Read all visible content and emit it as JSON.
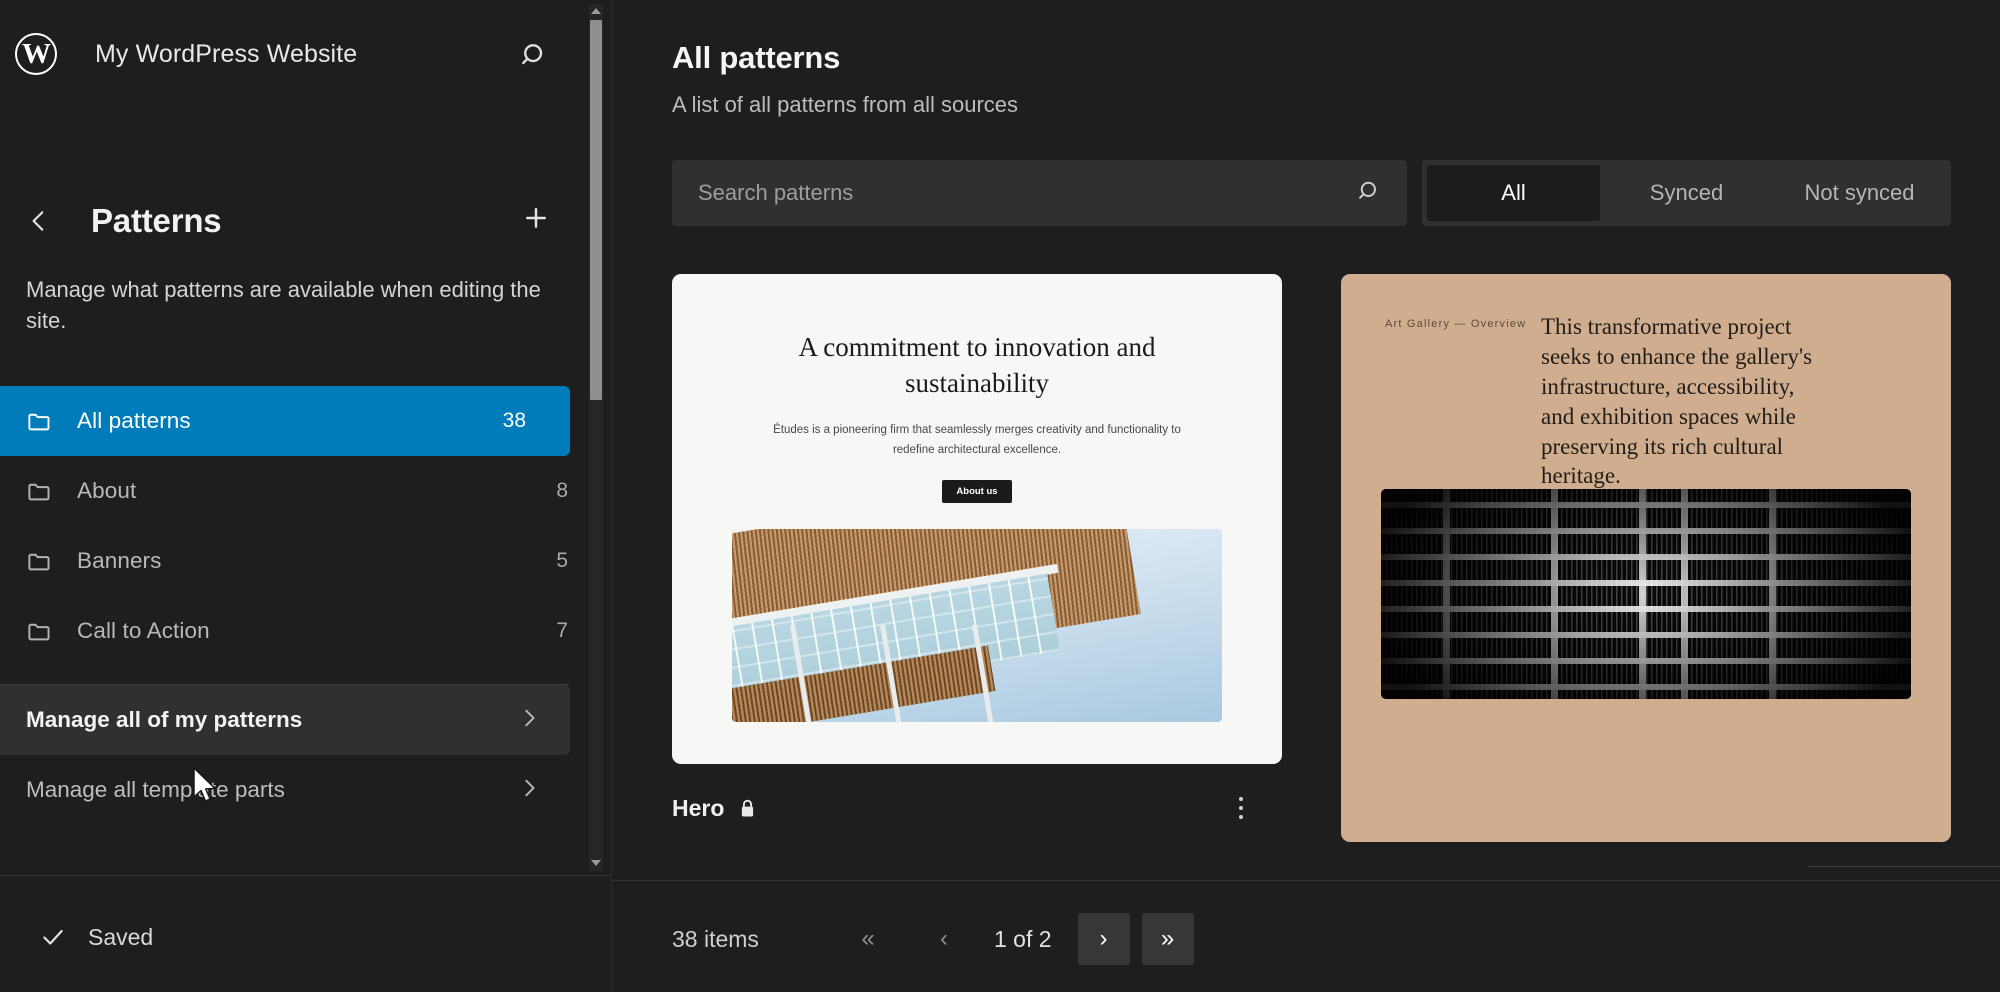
{
  "sidebar": {
    "site_title": "My WordPress Website",
    "logo_letter": "W",
    "search_icon": "search-icon",
    "back_icon": "chevron-left-icon",
    "add_icon": "plus-icon",
    "page_title": "Patterns",
    "description": "Manage what patterns are available when editing the site.",
    "nav_items": [
      {
        "label": "All patterns",
        "count": "38",
        "active": true
      },
      {
        "label": "About",
        "count": "8",
        "active": false
      },
      {
        "label": "Banners",
        "count": "5",
        "active": false
      },
      {
        "label": "Call to Action",
        "count": "7",
        "active": false
      }
    ],
    "manage_items": [
      {
        "label": "Manage all of my patterns",
        "hovered": true
      },
      {
        "label": "Manage all template parts",
        "hovered": false
      }
    ],
    "footer": {
      "status_label": "Saved",
      "check_icon": "check-icon"
    }
  },
  "main": {
    "title": "All patterns",
    "subtitle": "A list of all patterns from all sources",
    "search": {
      "placeholder": "Search patterns",
      "value": "",
      "icon": "search-icon"
    },
    "filters": [
      {
        "label": "All",
        "active": true
      },
      {
        "label": "Synced",
        "active": false
      },
      {
        "label": "Not synced",
        "active": false
      }
    ],
    "patterns": [
      {
        "preview": {
          "heading": "A commitment to innovation and sustainability",
          "body": "Études is a pioneering firm that seamlessly merges creativity and functionality to redefine architectural excellence.",
          "button": "About us",
          "image_alt": "modern-architecture-canopy-photo"
        },
        "label": "Hero",
        "lock_icon": "lock-icon",
        "menu_icon": "kebab-menu-icon"
      },
      {
        "preview": {
          "kicker": "Art Gallery — Overview",
          "body": "This transformative project seeks to enhance the gallery's infrastructure, accessibility, and exhibition spaces while preserving its rich cultural heritage.",
          "image_alt": "black-and-white-apartment-facade-photo"
        },
        "label": "",
        "lock_icon": "",
        "menu_icon": ""
      }
    ],
    "pagination": {
      "item_count": "38 items",
      "first_label": "«",
      "prev_label": "‹",
      "position": "1 of 2",
      "next_label": "›",
      "last_label": "»"
    }
  },
  "colors": {
    "accent": "#007cba",
    "app_bg": "#1e1e1e",
    "panel_bg": "#303030",
    "card1_bg": "#f7f7f5",
    "card2_bg": "#cfad8e"
  }
}
